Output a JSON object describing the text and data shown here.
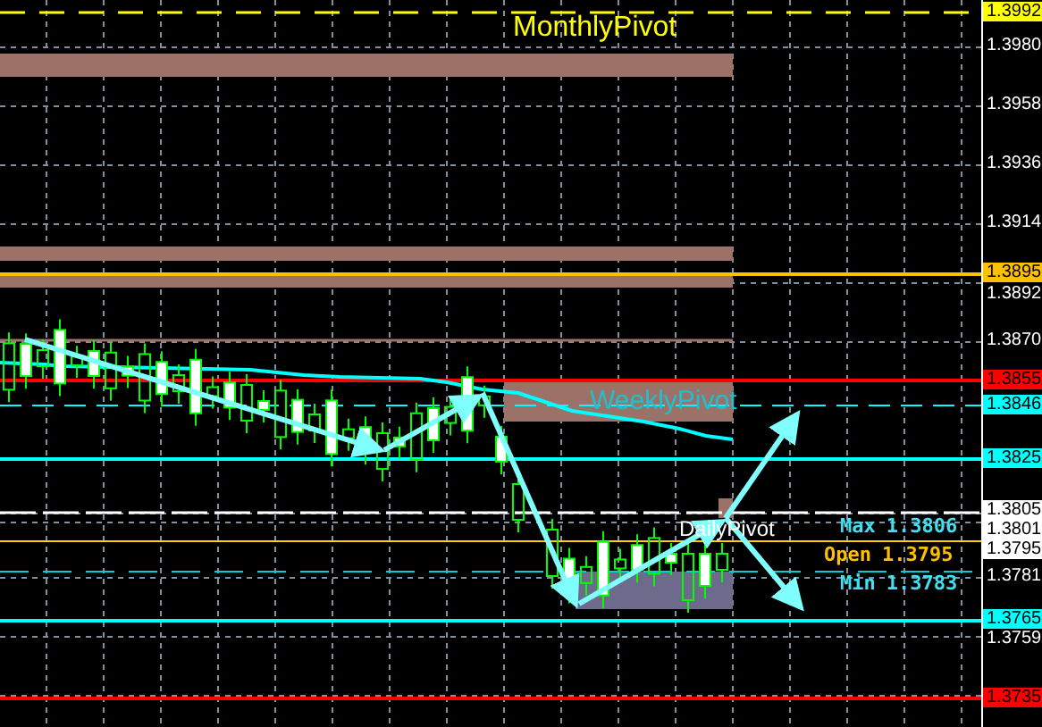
{
  "chart_labels": [
    {
      "text": "MonthlyPivot",
      "color": "#ffff00"
    },
    {
      "text": "WeeklyPivot",
      "color": "#20c0d0"
    },
    {
      "text": "DailyPivot",
      "color": "#ffffff"
    }
  ],
  "stats": [
    {
      "label": "Max",
      "value": "1.3806",
      "color": "#40e0f0"
    },
    {
      "label": "Open",
      "value": "1.3795",
      "color": "#ffc000"
    },
    {
      "label": "Min",
      "value": "1.3783",
      "color": "#40e0f0"
    }
  ],
  "price_axis": [
    {
      "text": "1.3992",
      "kind": "tag",
      "color": "#ffff00"
    },
    {
      "text": "1.3980",
      "kind": "tick"
    },
    {
      "text": "1.3958",
      "kind": "tick"
    },
    {
      "text": "1.3936",
      "kind": "tick"
    },
    {
      "text": "1.3914",
      "kind": "tick"
    },
    {
      "text": "1.3895",
      "kind": "tag",
      "color": "#ffc000"
    },
    {
      "text": "1.3892",
      "kind": "tick"
    },
    {
      "text": "1.3870",
      "kind": "tick"
    },
    {
      "text": "1.3855",
      "kind": "tag",
      "color": "#ff0000"
    },
    {
      "text": "1.3846",
      "kind": "tag",
      "color": "#00ffff"
    },
    {
      "text": "1.3825",
      "kind": "tag",
      "color": "#00ffff"
    },
    {
      "text": "1.3805",
      "kind": "tag",
      "color": "#ffffff"
    },
    {
      "text": "1.3801",
      "kind": "tag",
      "color": "#ffffff"
    },
    {
      "text": "1.3795",
      "kind": "tag",
      "color": "#ffffff"
    },
    {
      "text": "1.3781",
      "kind": "tick"
    },
    {
      "text": "1.3765",
      "kind": "tag",
      "color": "#00ffff"
    },
    {
      "text": "1.3759",
      "kind": "tick"
    },
    {
      "text": "1.3735",
      "kind": "tag",
      "color": "#ff0000"
    }
  ]
}
